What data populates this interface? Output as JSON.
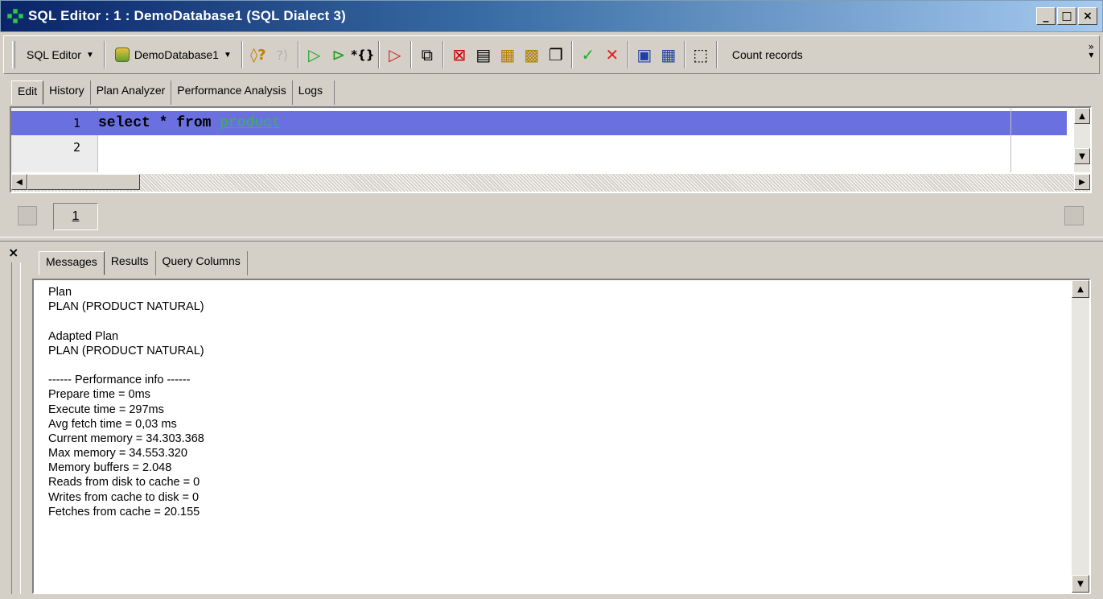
{
  "window": {
    "title": "SQL Editor : 1 : DemoDatabase1 (SQL Dialect 3)",
    "minimize": "_",
    "maximize": "□",
    "close": "×"
  },
  "toolbar": {
    "sql_editor_label": "SQL Editor",
    "database_label": "DemoDatabase1",
    "count_records_label": "Count records",
    "more": "»"
  },
  "editor_tabs": [
    {
      "label": "Edit",
      "active": true
    },
    {
      "label": "History"
    },
    {
      "label": "Plan Analyzer"
    },
    {
      "label": "Performance Analysis"
    },
    {
      "label": "Logs"
    }
  ],
  "editor": {
    "lines": [
      {
        "number": "1",
        "keyword_text": "select * from ",
        "table_text": "product"
      },
      {
        "number": "2",
        "keyword_text": "",
        "table_text": ""
      }
    ]
  },
  "page_strip": {
    "current_page": "1"
  },
  "results": {
    "close": "×",
    "tabs": [
      {
        "label": "Messages",
        "active": true
      },
      {
        "label": "Results"
      },
      {
        "label": "Query Columns"
      }
    ],
    "messages": [
      "Plan",
      "PLAN (PRODUCT NATURAL)",
      "",
      "Adapted Plan",
      "PLAN (PRODUCT NATURAL)",
      "",
      "------ Performance info ------",
      "Prepare time = 0ms",
      "Execute time = 297ms",
      "Avg fetch time = 0,03 ms",
      "Current memory = 34.303.368",
      "Max memory = 34.553.320",
      "Memory buffers = 2.048",
      "Reads from disk to cache = 0",
      "Writes from cache to disk = 0",
      "Fetches from cache = 20.155"
    ]
  }
}
